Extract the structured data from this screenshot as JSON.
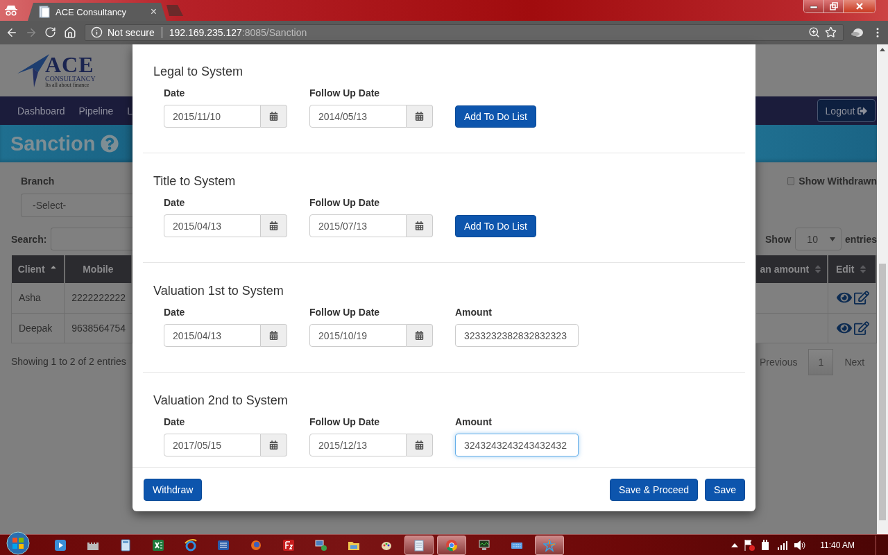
{
  "browser": {
    "tab_title": "ACE Consultancy",
    "tab_close": "×",
    "security": "Not secure",
    "url_host": "192.169.235.127",
    "url_rest": ":8085/Sanction"
  },
  "page": {
    "logo": {
      "name": "ACE",
      "sub": "CONSULTANCY",
      "tagline": "Its all about finance"
    },
    "nav": [
      "Dashboard",
      "Pipeline",
      "L"
    ],
    "logout": "Logout",
    "heading": "Sanction",
    "branch": {
      "label": "Branch",
      "value": "-Select-"
    },
    "show_withdrawn": {
      "label": "Show Withdrawn",
      "checked": false
    },
    "search": {
      "label": "Search:"
    },
    "length": {
      "prefix": "Show",
      "value": "10",
      "suffix": "entries"
    },
    "table": {
      "columns_left": [
        {
          "label": "Client",
          "sorted": true
        },
        {
          "label": "Mobile",
          "sorted": false,
          "sortable": false
        }
      ],
      "columns_right": [
        {
          "label": "an amount",
          "sorted": false,
          "sortable": true
        },
        {
          "label": "Edit",
          "sorted": false,
          "sortable": true
        }
      ],
      "rows": [
        {
          "client": "Asha",
          "mobile": "2222222222"
        },
        {
          "client": "Deepak",
          "mobile": "9638564754"
        }
      ]
    },
    "info": "Showing 1 to 2 of 2 entries",
    "pagination": {
      "previous": "Previous",
      "pages": [
        {
          "label": "1",
          "selected": true
        }
      ],
      "next": "Next"
    }
  },
  "modal": {
    "sections": [
      {
        "title": "Legal to System",
        "fields": [
          {
            "kind": "date",
            "label": "Date",
            "value": "2015/11/10",
            "focused": false
          },
          {
            "kind": "date",
            "label": "Follow Up Date",
            "value": "2014/05/13",
            "focused": false
          },
          {
            "kind": "button",
            "label": "Add To Do List"
          }
        ]
      },
      {
        "title": "Title to System",
        "fields": [
          {
            "kind": "date",
            "label": "Date",
            "value": "2015/04/13",
            "focused": false
          },
          {
            "kind": "date",
            "label": "Follow Up Date",
            "value": "2015/07/13",
            "focused": false
          },
          {
            "kind": "button",
            "label": "Add To Do List"
          }
        ]
      },
      {
        "title": "Valuation 1st to System",
        "fields": [
          {
            "kind": "date",
            "label": "Date",
            "value": "2015/04/13",
            "focused": false
          },
          {
            "kind": "date",
            "label": "Follow Up Date",
            "value": "2015/10/19",
            "focused": false
          },
          {
            "kind": "amount",
            "label": "Amount",
            "value": "3233232382832832323",
            "focused": false
          }
        ]
      },
      {
        "title": "Valuation 2nd to System",
        "fields": [
          {
            "kind": "date",
            "label": "Date",
            "value": "2017/05/15",
            "focused": false
          },
          {
            "kind": "date",
            "label": "Follow Up Date",
            "value": "2015/12/13",
            "focused": false
          },
          {
            "kind": "amount",
            "label": "Amount",
            "value": "3243243243243432432",
            "focused": true
          }
        ]
      }
    ],
    "footer_left": [
      "Withdraw"
    ],
    "footer_right": [
      "Save & Proceed",
      "Save"
    ]
  },
  "taskbar": {
    "apps": [
      {
        "kind": "player",
        "active": false
      },
      {
        "kind": "castle",
        "active": false
      },
      {
        "kind": "calculator",
        "active": false
      },
      {
        "kind": "sheet",
        "active": false
      },
      {
        "kind": "globe",
        "active": false
      },
      {
        "kind": "doc",
        "active": false
      },
      {
        "kind": "fox",
        "active": false
      },
      {
        "kind": "ftp",
        "active": false
      },
      {
        "kind": "remote",
        "active": false
      },
      {
        "kind": "folder",
        "active": false
      },
      {
        "kind": "paint",
        "active": false
      },
      {
        "kind": "notepad",
        "active": true
      },
      {
        "kind": "chrome",
        "active": true
      },
      {
        "kind": "monitor",
        "active": false
      },
      {
        "kind": "keyboard",
        "active": false
      },
      {
        "kind": "star",
        "active": true
      }
    ],
    "clock": "11:40 AM"
  }
}
